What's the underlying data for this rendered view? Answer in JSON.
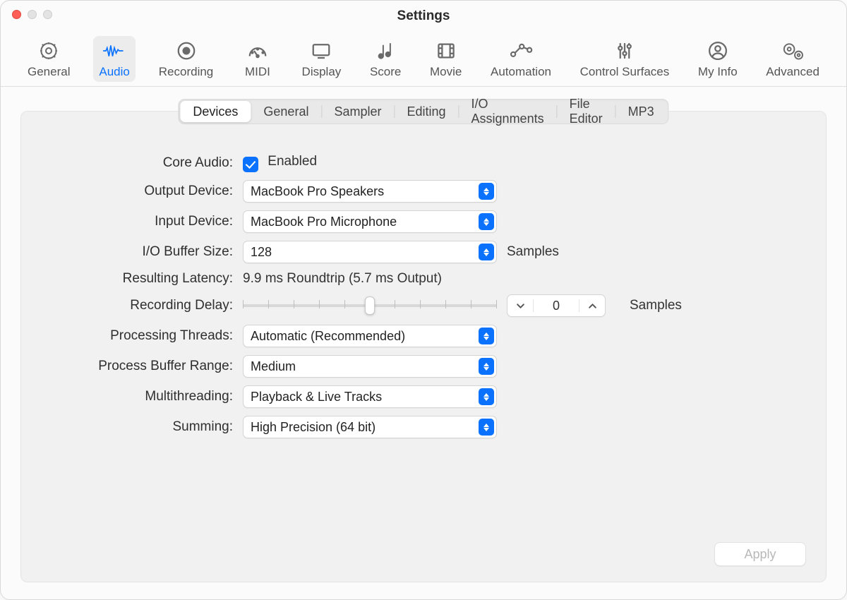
{
  "window": {
    "title": "Settings"
  },
  "toolbar": {
    "items": [
      {
        "name": "general",
        "label": "General"
      },
      {
        "name": "audio",
        "label": "Audio",
        "active": true
      },
      {
        "name": "recording",
        "label": "Recording"
      },
      {
        "name": "midi",
        "label": "MIDI"
      },
      {
        "name": "display",
        "label": "Display"
      },
      {
        "name": "score",
        "label": "Score"
      },
      {
        "name": "movie",
        "label": "Movie"
      },
      {
        "name": "automation",
        "label": "Automation"
      },
      {
        "name": "control-surfaces",
        "label": "Control Surfaces"
      },
      {
        "name": "my-info",
        "label": "My Info"
      },
      {
        "name": "advanced",
        "label": "Advanced"
      }
    ]
  },
  "subtabs": {
    "items": [
      {
        "label": "Devices",
        "active": true
      },
      {
        "label": "General"
      },
      {
        "label": "Sampler"
      },
      {
        "label": "Editing"
      },
      {
        "label": "I/O Assignments"
      },
      {
        "label": "File Editor"
      },
      {
        "label": "MP3"
      }
    ]
  },
  "form": {
    "core_audio": {
      "label": "Core Audio:",
      "value_label": "Enabled",
      "checked": true
    },
    "output_device": {
      "label": "Output Device:",
      "value": "MacBook Pro Speakers"
    },
    "input_device": {
      "label": "Input Device:",
      "value": "MacBook Pro Microphone"
    },
    "io_buffer": {
      "label": "I/O Buffer Size:",
      "value": "128",
      "unit": "Samples"
    },
    "latency": {
      "label": "Resulting Latency:",
      "value": "9.9 ms Roundtrip (5.7 ms Output)"
    },
    "recording_delay": {
      "label": "Recording Delay:",
      "value": "0",
      "unit": "Samples",
      "slider_pos_pct": 50
    },
    "processing_threads": {
      "label": "Processing Threads:",
      "value": "Automatic (Recommended)"
    },
    "process_buffer_range": {
      "label": "Process Buffer Range:",
      "value": "Medium"
    },
    "multithreading": {
      "label": "Multithreading:",
      "value": "Playback & Live Tracks"
    },
    "summing": {
      "label": "Summing:",
      "value": "High Precision (64 bit)"
    }
  },
  "footer": {
    "apply": "Apply"
  }
}
